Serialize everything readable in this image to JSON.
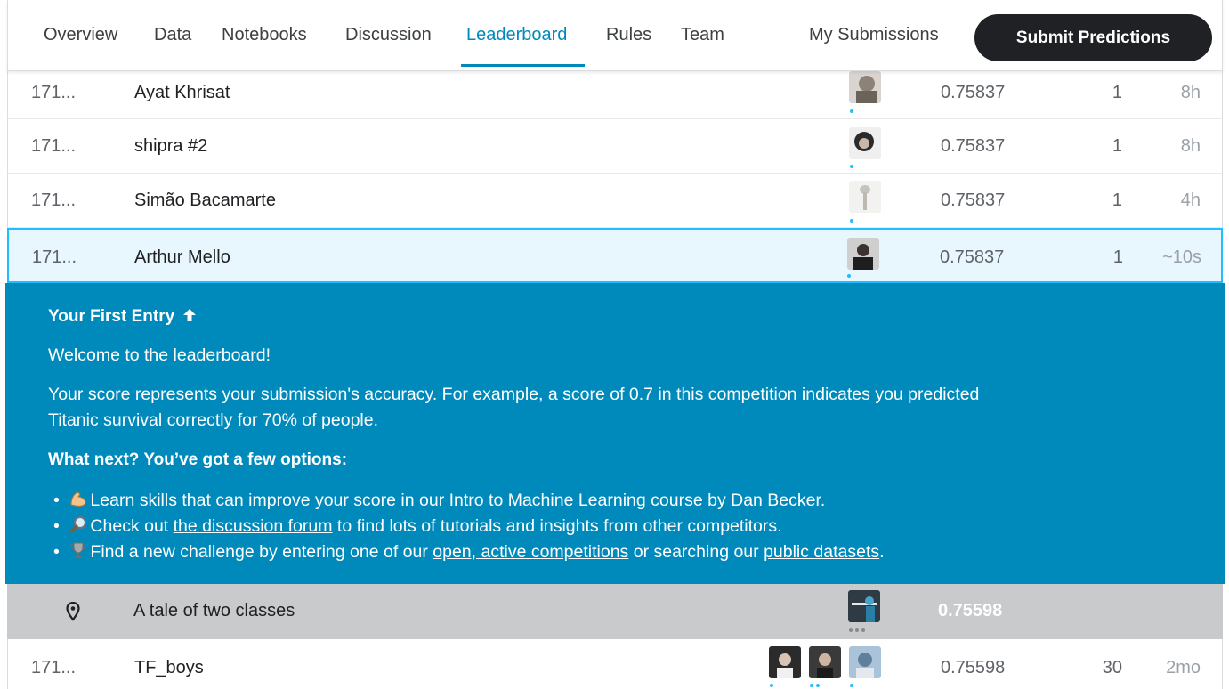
{
  "nav": {
    "tabs": [
      "Overview",
      "Data",
      "Notebooks",
      "Discussion",
      "Leaderboard",
      "Rules",
      "Team"
    ],
    "active_tab": "Leaderboard",
    "my_submissions": "My Submissions",
    "submit_label": "Submit Predictions"
  },
  "rows_above": [
    {
      "rank": "171...",
      "team": "Ayat Khrisat",
      "score": "0.75837",
      "entries": "1",
      "last": "8h"
    },
    {
      "rank": "171...",
      "team": "shipra #2",
      "score": "0.75837",
      "entries": "1",
      "last": "8h"
    },
    {
      "rank": "171...",
      "team": "Simão Bacamarte",
      "score": "0.75837",
      "entries": "1",
      "last": "4h"
    }
  ],
  "my_row": {
    "rank": "171...",
    "team": "Arthur Mello",
    "score": "0.75837",
    "entries": "1",
    "last": "~10s"
  },
  "welcome": {
    "title": "Your First Entry",
    "greeting": "Welcome to the leaderboard!",
    "desc_line1": "Your score represents your submission's accuracy. For example, a score of 0.7 in this competition indicates you predicted",
    "desc_line2": "Titanic survival correctly for 70% of people.",
    "next_title": "What next? You’ve got a few options:",
    "opt1_pre": "Learn skills that can improve your score in ",
    "opt1_link": "our Intro to Machine Learning course by Dan Becker",
    "opt1_post": ".",
    "opt2_pre": "Check out ",
    "opt2_link": "the discussion forum",
    "opt2_post": " to find lots of tutorials and insights from other competitors.",
    "opt3_pre": "Find a new challenge by entering one of our ",
    "opt3_link1": "open, active competitions",
    "opt3_mid": " or searching our ",
    "opt3_link2": "public datasets",
    "opt3_post": "."
  },
  "benchmark": {
    "name": "A tale of two classes",
    "score": "0.75598"
  },
  "row_below": {
    "rank": "171...",
    "team": "TF_boys",
    "score": "0.75598",
    "entries": "30",
    "last": "2mo"
  },
  "colors": {
    "accent": "#008abc",
    "highlight": "#20beff",
    "button": "#202124"
  }
}
